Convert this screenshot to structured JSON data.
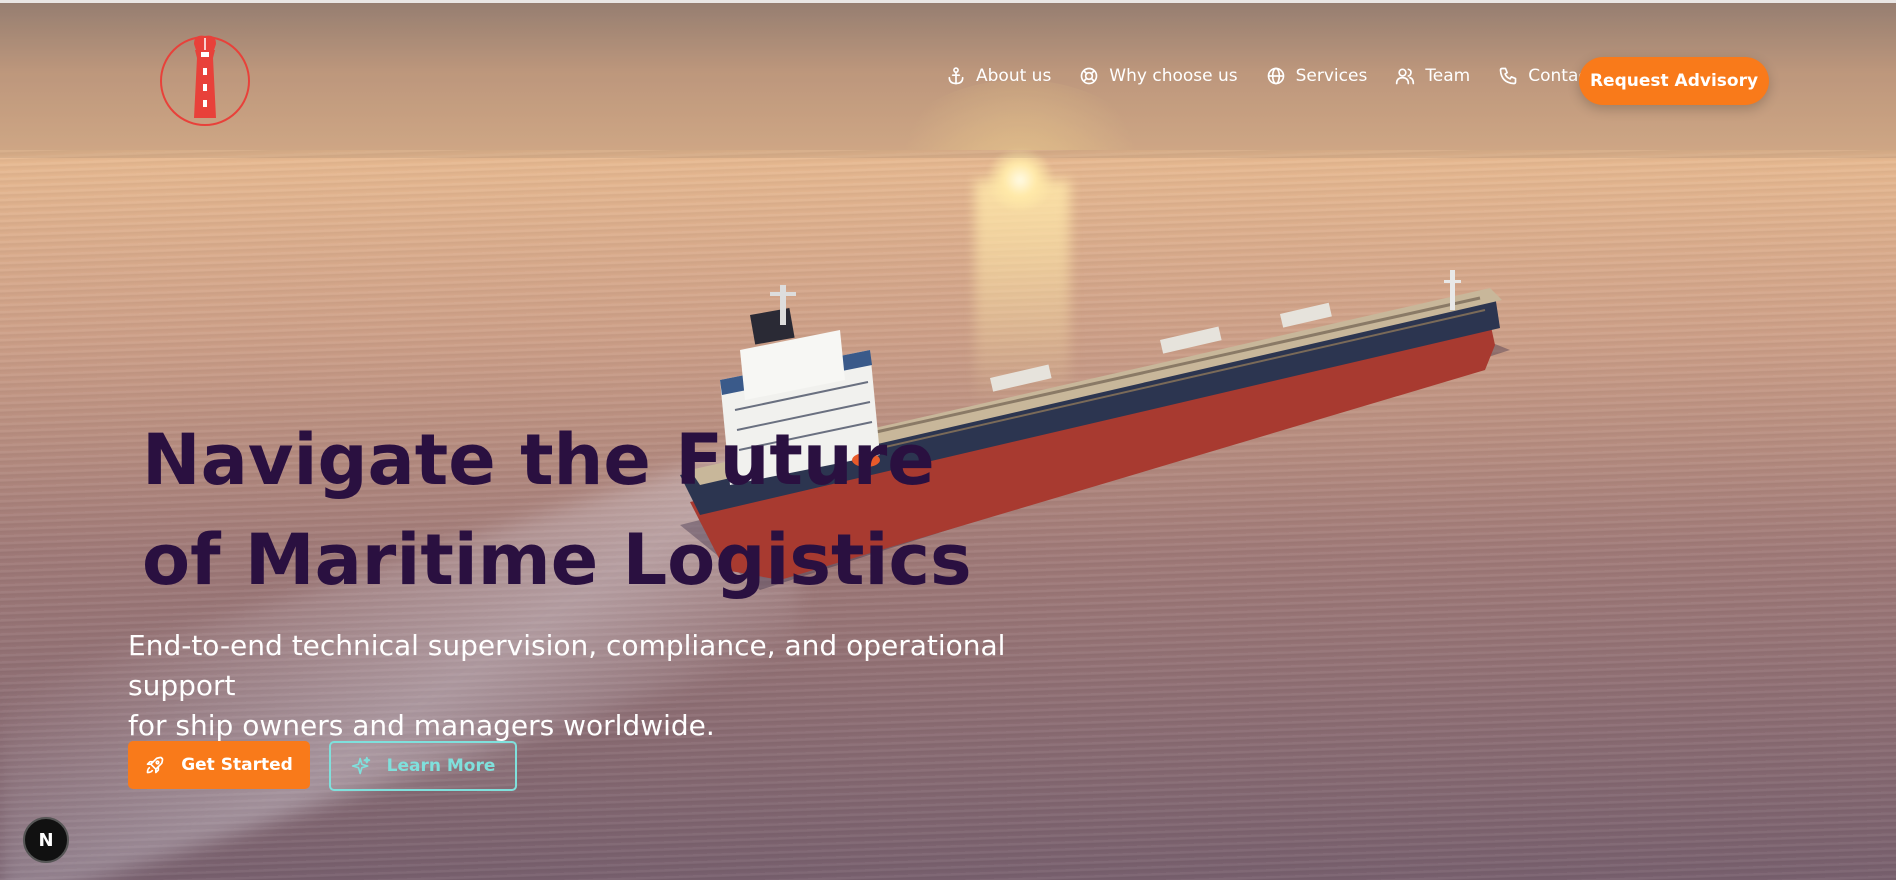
{
  "nav": {
    "items": [
      {
        "label": "About us",
        "icon": "anchor-icon"
      },
      {
        "label": "Why choose us",
        "icon": "lifebuoy-icon"
      },
      {
        "label": "Services",
        "icon": "globe-icon"
      },
      {
        "label": "Team",
        "icon": "users-icon"
      },
      {
        "label": "Contact",
        "icon": "phone-icon"
      }
    ],
    "cta_label": "Request Advisory"
  },
  "hero": {
    "title_line1": "Navigate the Future",
    "title_line2": "of Maritime Logistics",
    "subtitle_line1": "End-to-end technical supervision, compliance, and operational support",
    "subtitle_line2": "for ship owners and managers worldwide.",
    "primary_button": {
      "label": "Get Started",
      "icon": "rocket-icon"
    },
    "secondary_button": {
      "label": "Learn More",
      "icon": "sparkle-icon"
    }
  },
  "badge": {
    "letter": "N"
  },
  "colors": {
    "accent": "#f97a1a",
    "title": "#2a1040",
    "outline": "#7fe0dc",
    "logo": "#e8413a"
  }
}
